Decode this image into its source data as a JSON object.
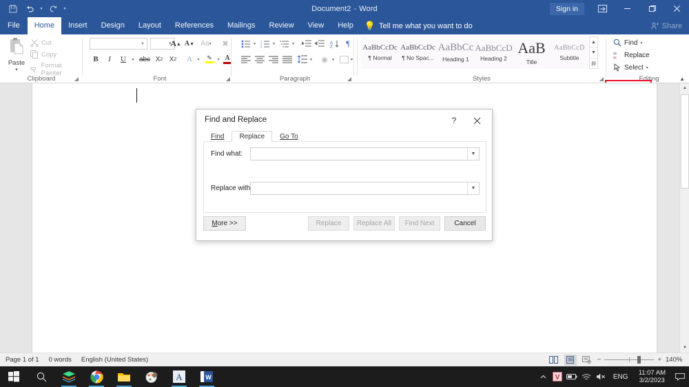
{
  "titlebar": {
    "document_title": "Document2",
    "app_name": "Word",
    "separator": "-",
    "sign_in": "Sign in",
    "quick_access": [
      {
        "name": "save-icon",
        "label": "Save"
      },
      {
        "name": "undo-icon",
        "label": "Undo"
      },
      {
        "name": "redo-icon",
        "label": "Redo"
      },
      {
        "name": "customize-qat-icon",
        "label": "Customize Quick Access Toolbar"
      }
    ],
    "window_buttons": {
      "ribbon_display": "Ribbon Display Options",
      "minimize": "Minimize",
      "restore": "Restore Down",
      "close": "Close"
    }
  },
  "tabs": [
    {
      "label": "File",
      "active": false
    },
    {
      "label": "Home",
      "active": true
    },
    {
      "label": "Insert",
      "active": false
    },
    {
      "label": "Design",
      "active": false
    },
    {
      "label": "Layout",
      "active": false
    },
    {
      "label": "References",
      "active": false
    },
    {
      "label": "Mailings",
      "active": false
    },
    {
      "label": "Review",
      "active": false
    },
    {
      "label": "View",
      "active": false
    },
    {
      "label": "Help",
      "active": false
    }
  ],
  "tell_me": "Tell me what you want to do",
  "share": "Share",
  "ribbon": {
    "groups": [
      {
        "name": "Clipboard"
      },
      {
        "name": "Font"
      },
      {
        "name": "Paragraph"
      },
      {
        "name": "Styles"
      },
      {
        "name": "Editing"
      }
    ],
    "clipboard": {
      "paste": "Paste",
      "cut": "Cut",
      "copy": "Copy",
      "format_painter": "Format Painter"
    },
    "font": {
      "font_name_value": "",
      "font_size_value": ""
    },
    "styles": [
      {
        "preview": "AaBbCcDc",
        "name": "¶ Normal",
        "size": "11px"
      },
      {
        "preview": "AaBbCcDc",
        "name": "¶ No Spac...",
        "size": "11px"
      },
      {
        "preview": "AaBbCc",
        "name": "Heading 1",
        "size": "15px"
      },
      {
        "preview": "AaBbCcD",
        "name": "Heading 2",
        "size": "13px"
      },
      {
        "preview": "AaB",
        "name": "Title",
        "size": "22px"
      },
      {
        "preview": "AaBbCcD",
        "name": "Subtitle",
        "size": "10px"
      }
    ],
    "editing": {
      "find": "Find",
      "replace": "Replace",
      "select": "Select",
      "highlighted_item": "Replace",
      "highlight_color": "#e8112d"
    }
  },
  "dialog": {
    "title": "Find and Replace",
    "help_glyph": "?",
    "tabs": [
      {
        "label": "Find",
        "active": false
      },
      {
        "label": "Replace",
        "active": true
      },
      {
        "label": "Go To",
        "active": false
      }
    ],
    "fields": [
      {
        "label": "Find what:",
        "value": "",
        "placeholder": ""
      },
      {
        "label": "Replace with:",
        "value": "",
        "placeholder": ""
      }
    ],
    "buttons": [
      {
        "label": "More >>",
        "enabled": true
      },
      {
        "label": "Replace",
        "enabled": false
      },
      {
        "label": "Replace All",
        "enabled": false
      },
      {
        "label": "Find Next",
        "enabled": false
      },
      {
        "label": "Cancel",
        "enabled": true
      }
    ]
  },
  "statusbar": {
    "page": "Page 1 of 1",
    "words": "0 words",
    "language": "English (United States)",
    "views": [
      {
        "name": "read-mode-icon",
        "active": false
      },
      {
        "name": "print-layout-icon",
        "active": true
      },
      {
        "name": "web-layout-icon",
        "active": false
      }
    ],
    "zoom_out": "−",
    "zoom_in": "+",
    "zoom_level": "140%"
  },
  "taskbar": {
    "items": [
      {
        "name": "start-button",
        "label": "Start"
      },
      {
        "name": "search-icon",
        "label": "Search"
      },
      {
        "name": "bluestacks-icon",
        "label": "BlueStacks"
      },
      {
        "name": "chrome-icon",
        "label": "Google Chrome"
      },
      {
        "name": "file-explorer-icon",
        "label": "File Explorer"
      },
      {
        "name": "paint-icon",
        "label": "Paint"
      },
      {
        "name": "app-a-icon",
        "label": "A"
      },
      {
        "name": "word-icon",
        "label": "Word"
      }
    ],
    "tray": {
      "show_hidden": "˄",
      "v_app": "V",
      "battery": "battery-icon",
      "network": "wifi-icon",
      "volume": "speaker-muted-icon",
      "language": "ENG",
      "time": "11:07 AM",
      "date": "3/2/2023",
      "notifications": "notification-icon"
    }
  }
}
